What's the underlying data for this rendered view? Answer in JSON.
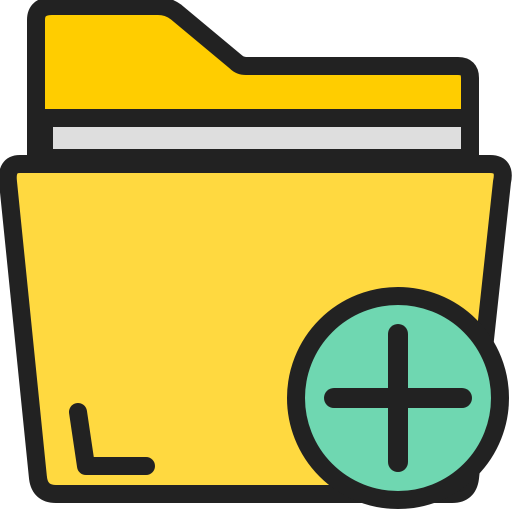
{
  "icon": {
    "name": "add-folder-icon",
    "parts": [
      "folder-back-icon",
      "paper-sheet-icon",
      "folder-front-icon",
      "plus-circle-icon"
    ]
  },
  "colors": {
    "outline": "#222222",
    "folder_back": "#FFCD00",
    "paper": "#DEDEDE",
    "folder_front": "#FFD940",
    "plus_badge": "#6FD7B1",
    "background": "#FFFFFF"
  }
}
